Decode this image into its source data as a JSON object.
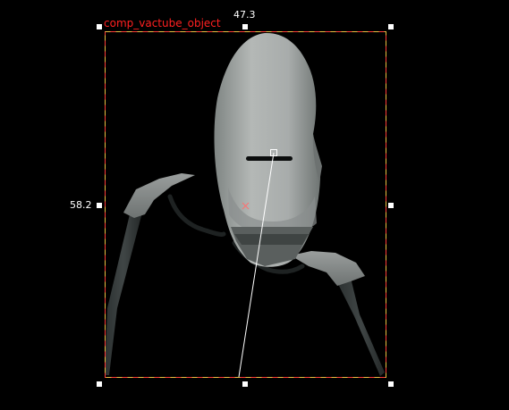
{
  "viewport": {
    "object_name": "comp_vactube_object",
    "width_readout": "47.3",
    "height_readout": "58.2"
  },
  "colors": {
    "background": "#000000",
    "label": "#ff2020",
    "bbox_outline": "#ff3a3a",
    "bbox_dash": "#e8c040",
    "handle": "#ffffff",
    "text": "#ffffff",
    "model_shell": "#a9adac",
    "model_dark": "#1b1f1f"
  },
  "icons": {
    "handle": "square-handle-icon",
    "origin": "origin-cross-icon",
    "pivot": "pivot-point-icon"
  }
}
